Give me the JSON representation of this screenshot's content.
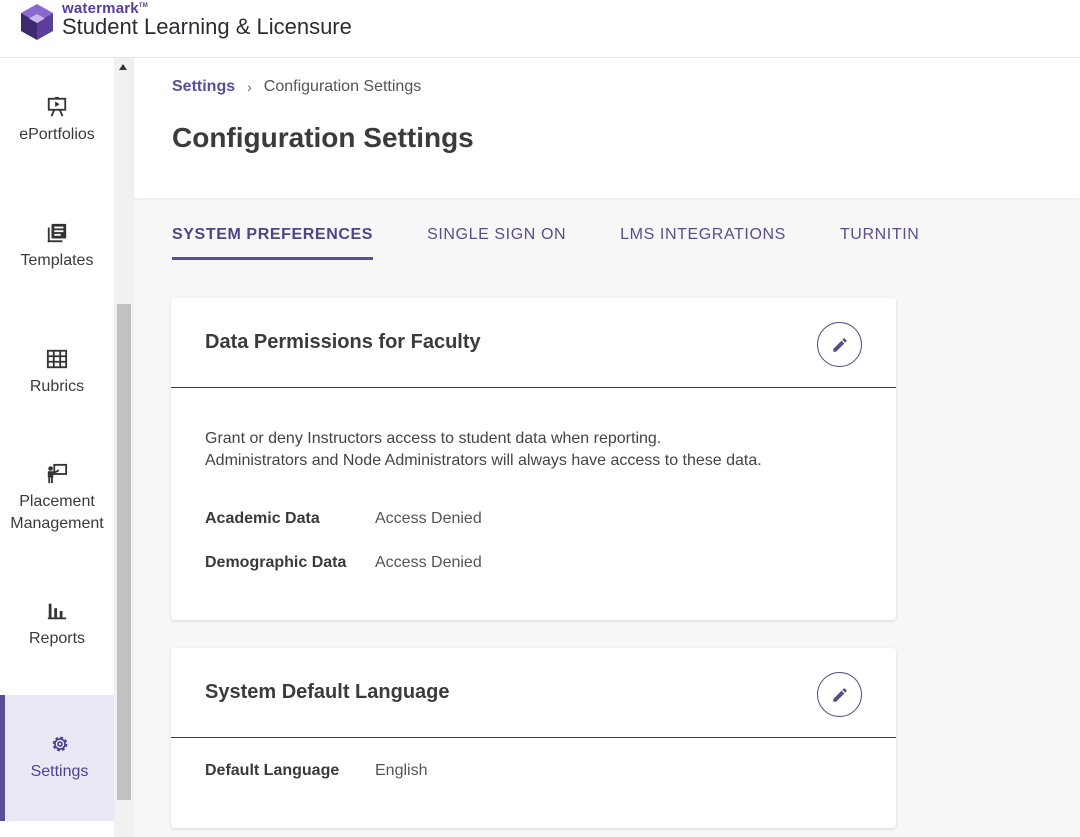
{
  "brand": {
    "company": "watermark",
    "trademark": "TM",
    "product": "Student Learning & Licensure"
  },
  "sidebar": {
    "items": [
      {
        "label": "ePortfolios",
        "icon": "presentation-board-icon"
      },
      {
        "label": "Templates",
        "icon": "library-books-icon"
      },
      {
        "label": "Rubrics",
        "icon": "grid-table-icon"
      },
      {
        "label": "Placement Management",
        "icon": "person-presenting-icon"
      },
      {
        "label": "Reports",
        "icon": "bar-chart-icon"
      },
      {
        "label": "Settings",
        "icon": "gear-icon",
        "active": true
      }
    ]
  },
  "breadcrumb": {
    "parent": "Settings",
    "separator": "›",
    "current": "Configuration Settings"
  },
  "page": {
    "title": "Configuration Settings"
  },
  "tabs": [
    {
      "label": "SYSTEM PREFERENCES",
      "active": true
    },
    {
      "label": "SINGLE SIGN ON",
      "active": false
    },
    {
      "label": "LMS INTEGRATIONS",
      "active": false
    },
    {
      "label": "TURNITIN",
      "active": false
    }
  ],
  "cards": {
    "data_permissions": {
      "title": "Data Permissions for Faculty",
      "description": "Grant or deny Instructors access to student data when reporting. Administrators and Node Administrators will always have access to these data.",
      "fields": [
        {
          "key": "Academic Data",
          "value": "Access Denied"
        },
        {
          "key": "Demographic Data",
          "value": "Access Denied"
        }
      ]
    },
    "language": {
      "title": "System Default Language",
      "fields": [
        {
          "key": "Default Language",
          "value": "English"
        }
      ]
    }
  },
  "colors": {
    "accent": "#5a4e99",
    "active_nav_bg": "#ebe8f5",
    "logo_dark": "#3b2a6e",
    "logo_light": "#8a6ad0"
  }
}
